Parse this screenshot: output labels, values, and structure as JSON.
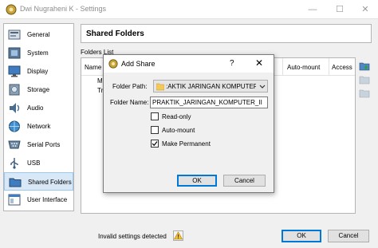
{
  "window": {
    "title": "Dwi Nugraheni K - Settings",
    "min": "—",
    "max": "☐",
    "close": "✕"
  },
  "sidebar": {
    "items": [
      {
        "label": "General",
        "icon": "general-icon",
        "selected": false
      },
      {
        "label": "System",
        "icon": "system-icon",
        "selected": false
      },
      {
        "label": "Display",
        "icon": "display-icon",
        "selected": false
      },
      {
        "label": "Storage",
        "icon": "storage-icon",
        "selected": false
      },
      {
        "label": "Audio",
        "icon": "audio-icon",
        "selected": false
      },
      {
        "label": "Network",
        "icon": "network-icon",
        "selected": false
      },
      {
        "label": "Serial Ports",
        "icon": "serial-ports-icon",
        "selected": false
      },
      {
        "label": "USB",
        "icon": "usb-icon",
        "selected": false
      },
      {
        "label": "Shared Folders",
        "icon": "shared-folders-icon",
        "selected": true
      },
      {
        "label": "User Interface",
        "icon": "user-interface-icon",
        "selected": false
      }
    ]
  },
  "main": {
    "title": "Shared Folders",
    "folders_list_label": "Folders List",
    "columns": {
      "name": "Name",
      "automount": "Auto-mount",
      "access": "Access"
    },
    "tree": [
      "M",
      "Tr"
    ]
  },
  "status": {
    "text": "Invalid settings detected",
    "icon": "warning-icon"
  },
  "buttons": {
    "ok": "OK",
    "cancel": "Cancel"
  },
  "dialog": {
    "title": "Add Share",
    "help": "?",
    "close": "✕",
    "folder_path_label": "Folder Path:",
    "folder_path_value": ":AKTIK JARINGAN KOMPUTER II",
    "folder_name_label": "Folder Name:",
    "folder_name_value": "PRAKTIK_JARINGAN_KOMPUTER_II",
    "checkboxes": [
      {
        "label": "Read-only",
        "checked": false
      },
      {
        "label": "Auto-mount",
        "checked": false
      },
      {
        "label": "Make Permanent",
        "checked": true
      }
    ],
    "ok": "OK",
    "cancel": "Cancel"
  },
  "colors": {
    "selection": "#d9e8f7",
    "selection_border": "#99c8f0",
    "default_button_border": "#0078d7"
  }
}
